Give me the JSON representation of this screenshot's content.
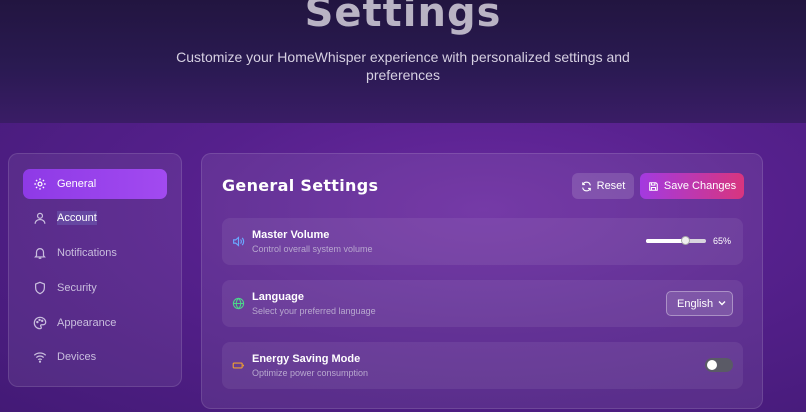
{
  "header": {
    "title": "Settings",
    "subtitle": "Customize your HomeWhisper experience with personalized settings and preferences"
  },
  "sidebar": {
    "items": [
      {
        "label": "General",
        "icon": "gear-icon",
        "active": true
      },
      {
        "label": "Account",
        "icon": "user-icon"
      },
      {
        "label": "Notifications",
        "icon": "bell-icon"
      },
      {
        "label": "Security",
        "icon": "shield-icon"
      },
      {
        "label": "Appearance",
        "icon": "palette-icon"
      },
      {
        "label": "Devices",
        "icon": "wifi-icon"
      }
    ]
  },
  "panel": {
    "title": "General Settings",
    "reset_label": "Reset",
    "save_label": "Save Changes",
    "settings": [
      {
        "title": "Master Volume",
        "description": "Control overall system volume",
        "icon": "volume-icon",
        "value_label": "65%",
        "value": 0.65
      },
      {
        "title": "Language",
        "description": "Select your preferred language",
        "icon": "globe-icon",
        "selected": "English"
      },
      {
        "title": "Energy Saving Mode",
        "description": "Optimize power consumption",
        "icon": "battery-icon",
        "enabled": false
      }
    ]
  },
  "colors": {
    "accent": "#9a40ea",
    "save_gradient_end": "#d8357e",
    "volume_icon": "#6aa8ff",
    "globe_icon": "#4cd68a",
    "battery_icon": "#f0a030"
  }
}
